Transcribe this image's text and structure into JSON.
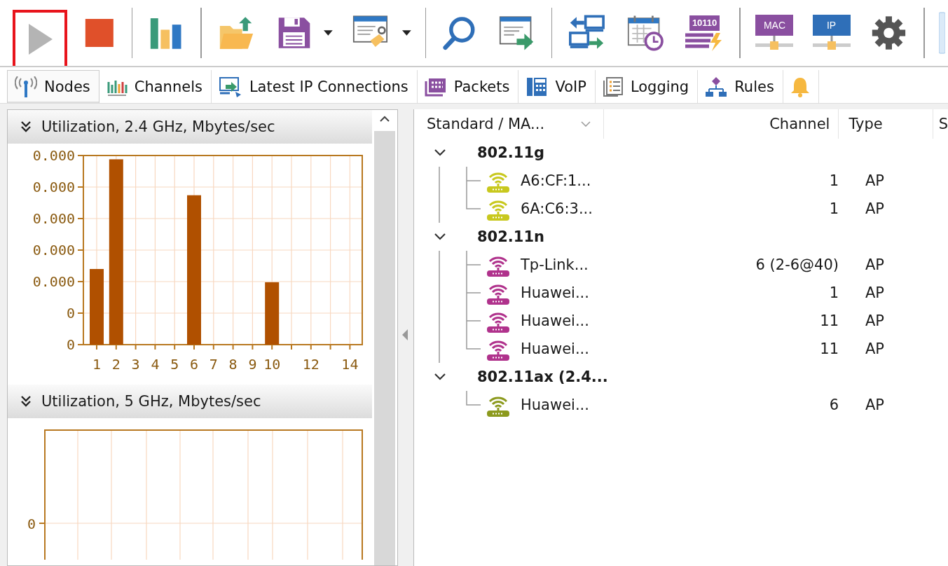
{
  "toolbar": {
    "groups": [
      [
        {
          "kind": "play",
          "disabled": true,
          "highlighted": true
        },
        {
          "kind": "stop",
          "disabled": false,
          "highlighted": false
        }
      ],
      [
        {
          "kind": "chart",
          "disabled": false,
          "highlighted": false
        }
      ],
      [
        {
          "kind": "open",
          "disabled": false,
          "highlighted": false
        },
        {
          "kind": "save",
          "disabled": false,
          "highlighted": false
        },
        {
          "kind": "dropdown",
          "disabled": false,
          "highlighted": false
        },
        {
          "kind": "edit",
          "disabled": false,
          "highlighted": false
        },
        {
          "kind": "dropdown",
          "disabled": false,
          "highlighted": false
        }
      ],
      [
        {
          "kind": "search",
          "disabled": false,
          "highlighted": false
        },
        {
          "kind": "export",
          "disabled": false,
          "highlighted": false
        }
      ],
      [
        {
          "kind": "network",
          "disabled": false,
          "highlighted": false
        },
        {
          "kind": "schedule",
          "disabled": false,
          "highlighted": false
        },
        {
          "kind": "binary",
          "label": "10110",
          "disabled": false,
          "highlighted": false
        }
      ],
      [
        {
          "kind": "mac",
          "label": "MAC",
          "disabled": false,
          "highlighted": false
        },
        {
          "kind": "ip",
          "label": "IP",
          "disabled": false,
          "highlighted": false
        },
        {
          "kind": "settings",
          "disabled": false,
          "highlighted": false
        }
      ],
      [
        {
          "kind": "partial",
          "disabled": false,
          "highlighted": false
        }
      ]
    ]
  },
  "tabs": [
    {
      "kind": "nodes",
      "label": "Nodes",
      "selected": true
    },
    {
      "kind": "channels",
      "label": "Channels",
      "selected": false
    },
    {
      "kind": "connections",
      "label": "Latest IP Connections",
      "selected": false
    },
    {
      "kind": "packets",
      "label": "Packets",
      "selected": false
    },
    {
      "kind": "voip",
      "label": "VoIP",
      "selected": false
    },
    {
      "kind": "logging",
      "label": "Logging",
      "selected": false
    },
    {
      "kind": "rules",
      "label": "Rules",
      "selected": false
    },
    {
      "kind": "alerts",
      "selected": false
    }
  ],
  "panels": [
    {
      "title": "Utilization, 2.4 GHz, Mbytes/sec",
      "y_tick_labels": [
        "0.000",
        "0.000",
        "0.000",
        "0.000",
        "0.000",
        "0",
        "0"
      ],
      "x_tick_labels": [
        "1",
        "2",
        "3",
        "4",
        "5",
        "6",
        "7",
        "8",
        "9",
        "10",
        "12",
        "14"
      ]
    },
    {
      "title": "Utilization, 5 GHz, Mbytes/sec",
      "y_tick_labels": [
        "0"
      ]
    }
  ],
  "table": {
    "columns": [
      "Standard / MA...",
      "Channel",
      "Type",
      "S"
    ],
    "groups": [
      {
        "name": "802.11g",
        "expanded": true,
        "children": [
          {
            "name": "A6:CF:1...",
            "channel": "1",
            "type": "AP",
            "color": "#c8c81e"
          },
          {
            "name": "6A:C6:3...",
            "channel": "1",
            "type": "AP",
            "color": "#c8c81e"
          }
        ]
      },
      {
        "name": "802.11n",
        "expanded": true,
        "children": [
          {
            "name": "Tp-Link...",
            "channel": "6 (2-6@40)",
            "type": "AP",
            "color": "#b0328c"
          },
          {
            "name": "Huawei...",
            "channel": "1",
            "type": "AP",
            "color": "#b0328c"
          },
          {
            "name": "Huawei...",
            "channel": "11",
            "type": "AP",
            "color": "#b0328c"
          },
          {
            "name": "Huawei...",
            "channel": "11",
            "type": "AP",
            "color": "#b0328c"
          }
        ]
      },
      {
        "name": "802.11ax (2.4...",
        "expanded": true,
        "children": [
          {
            "name": "Huawei...",
            "channel": "6",
            "type": "AP",
            "color": "#8c9a1e"
          }
        ]
      }
    ]
  }
}
